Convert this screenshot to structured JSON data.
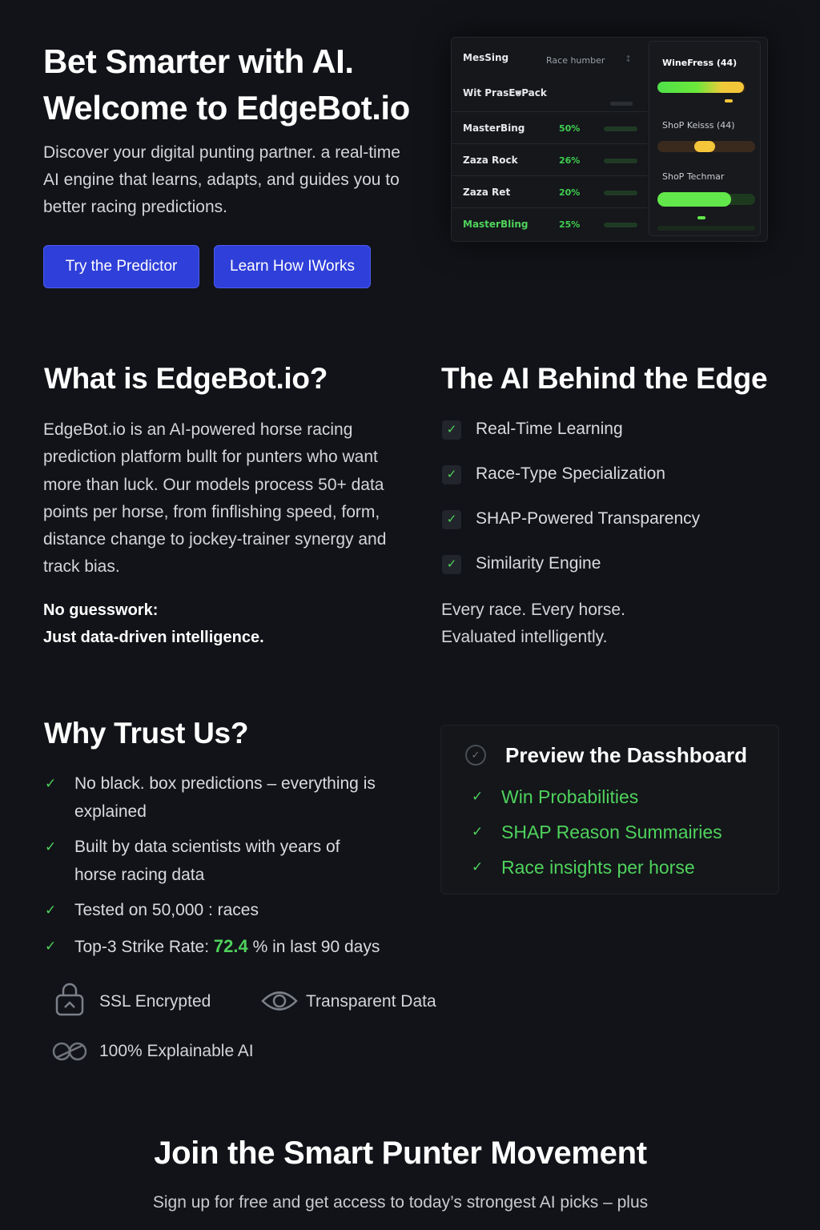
{
  "hero": {
    "title_line1": "Bet Smarter with AI.",
    "title_line2": "Welcome to EdgeBot.io",
    "description": "Discover your digital punting partner. a real-time AI engine that learns, adapts, and guides you to better racing predictions.",
    "primary_button": "Try the Predictor",
    "secondary_button": "Learn How IWorks"
  },
  "dashboard_mock": {
    "header_col1": "MesSing",
    "header_col2": "Race humber",
    "subheader": "Wit PrasE⩐Pack",
    "rows": [
      {
        "name": "MasterBing",
        "pct": "50%"
      },
      {
        "name": "Zaza Rock",
        "pct": "26%"
      },
      {
        "name": "Zaza Ret",
        "pct": "20%"
      },
      {
        "name": "MasterBling",
        "pct": "25%"
      }
    ],
    "panel": {
      "label1": "WineFress (44)",
      "label2": "ShoP Keisss (44)",
      "label3": "ShoP Techmar"
    }
  },
  "what": {
    "title": "What is EdgeBot.io?",
    "text": "EdgeBot.io is an AI-powered horse racing prediction platform bullt for punters who want more than luck. Our models process 50+ data points per horse, from finflishing speed, form, distance change to jockey-trainer synergy and track bias.",
    "bold_line1": "No guesswork:",
    "bold_line2": "Just data-driven intelligence."
  },
  "ai": {
    "title": "The AI Behind the Edge",
    "features": [
      "Real-Time Learning",
      "Race-Type Specialization",
      "SHAP-Powered Transparency",
      "Similarity Engine"
    ],
    "tail_line1": "Every race. Every horse.",
    "tail_line2": "Evaluated intelligently."
  },
  "trust": {
    "title": "Why Trust Us?",
    "items": [
      "No black. box predictions – everything is explained",
      "Built by data scientists with years of horse racing data",
      "Tested on 50,000 : races"
    ],
    "strike_prefix": "Top-3 Strike Rate: ",
    "strike_value": "72.4",
    "strike_suffix": " % in last 90 days",
    "badges": {
      "ssl": "SSL Encrypted",
      "transparent": "Transparent Data",
      "explainable": "100% Explainable AI"
    }
  },
  "preview": {
    "title": "Preview the Dasshboard",
    "items": [
      "Win Probabilities",
      "SHAP Reason Summairies",
      "Race insights per horse"
    ]
  },
  "join": {
    "title": "Join the Smart Punter Movement",
    "text": "Sign up for free and get access to today’s strongest AI picks – plus"
  },
  "colors": {
    "background": "#121318",
    "accent_green": "#4fd25c",
    "button_blue": "#2f3fd9"
  }
}
